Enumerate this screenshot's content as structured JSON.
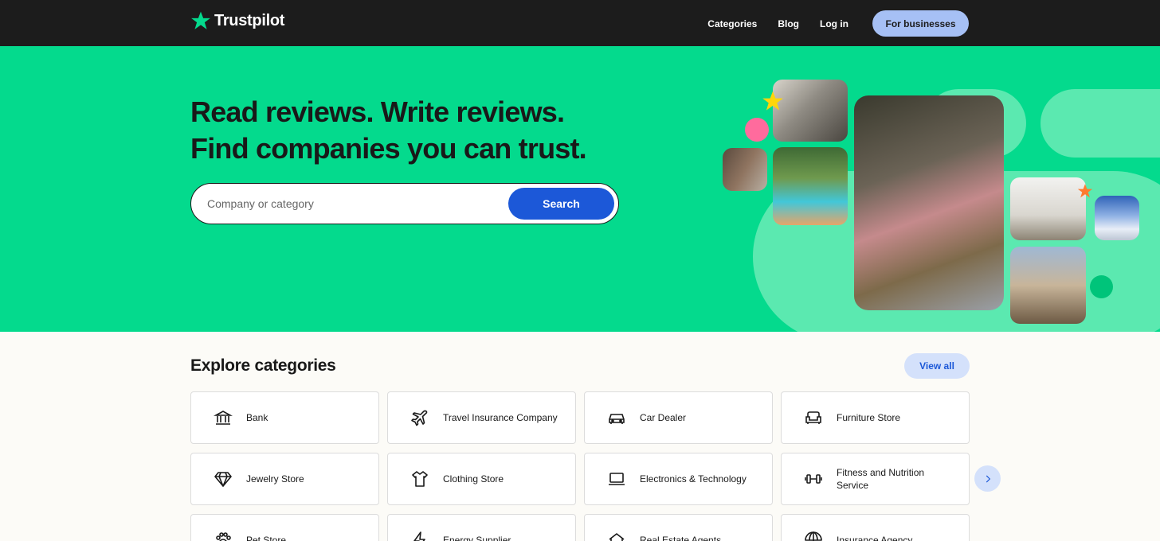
{
  "nav": {
    "brand": "Trustpilot",
    "links": [
      "Categories",
      "Blog",
      "Log in"
    ],
    "business_label": "For businesses"
  },
  "hero": {
    "headline_line1": "Read reviews. Write reviews.",
    "headline_line2": "Find companies you can trust.",
    "search_placeholder": "Company or category",
    "search_button": "Search"
  },
  "categories": {
    "title": "Explore categories",
    "view_all": "View all",
    "items": [
      {
        "label": "Bank",
        "icon": "bank-icon"
      },
      {
        "label": "Travel Insurance Company",
        "icon": "airplane-icon"
      },
      {
        "label": "Car Dealer",
        "icon": "car-icon"
      },
      {
        "label": "Furniture Store",
        "icon": "sofa-icon"
      },
      {
        "label": "Jewelry Store",
        "icon": "diamond-icon"
      },
      {
        "label": "Clothing Store",
        "icon": "shirt-icon"
      },
      {
        "label": "Electronics & Technology",
        "icon": "laptop-icon"
      },
      {
        "label": "Fitness and Nutrition Service",
        "icon": "dumbbell-icon"
      },
      {
        "label": "Pet Store",
        "icon": "paw-icon"
      },
      {
        "label": "Energy Supplier",
        "icon": "lightning-icon"
      },
      {
        "label": "Real Estate Agents",
        "icon": "house-icon"
      },
      {
        "label": "Insurance Agency",
        "icon": "umbrella-icon"
      }
    ]
  },
  "colors": {
    "brand_green": "#04da8d",
    "nav_bg": "#1c1c1c",
    "search_blue": "#1c58d8",
    "business_btn": "#a6c0f5"
  }
}
